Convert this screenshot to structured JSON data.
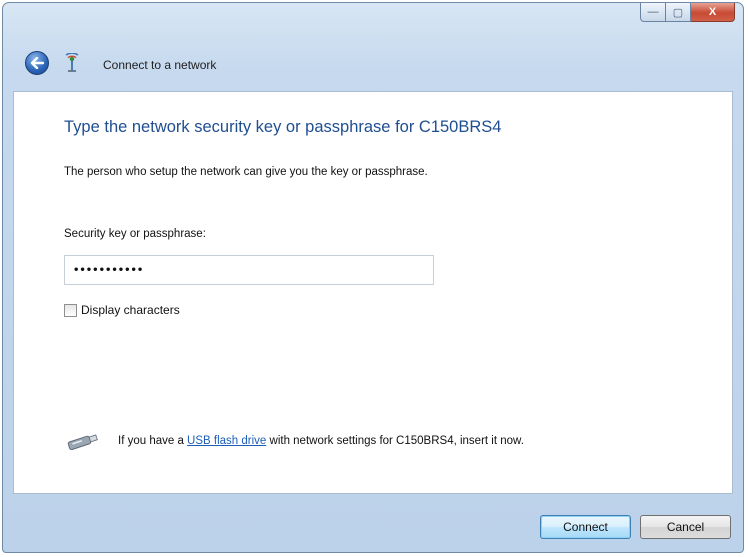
{
  "window": {
    "title": "Connect to a network",
    "minimize_glyph": "—",
    "maximize_glyph": "▢",
    "close_glyph": "X"
  },
  "main": {
    "heading": "Type the network security key or passphrase for C150BRS4",
    "description": "The person who setup the network can give you the key or passphrase.",
    "key_label": "Security key or passphrase:",
    "key_value": "•••••••••••",
    "display_characters": {
      "label": "Display characters",
      "checked": false
    },
    "usb": {
      "text_before": "If you have a ",
      "link_text": "USB flash drive",
      "text_after": " with network settings for C150BRS4, insert it now."
    }
  },
  "footer": {
    "connect_label": "Connect",
    "cancel_label": "Cancel"
  },
  "icons": {
    "back": "back-arrow-icon",
    "network": "network-icon",
    "usb": "usb-drive-icon"
  },
  "colors": {
    "heading": "#1f4e91",
    "link": "#1d5fb8",
    "frame": "#c6d9ee",
    "close_button": "#c74a34"
  }
}
